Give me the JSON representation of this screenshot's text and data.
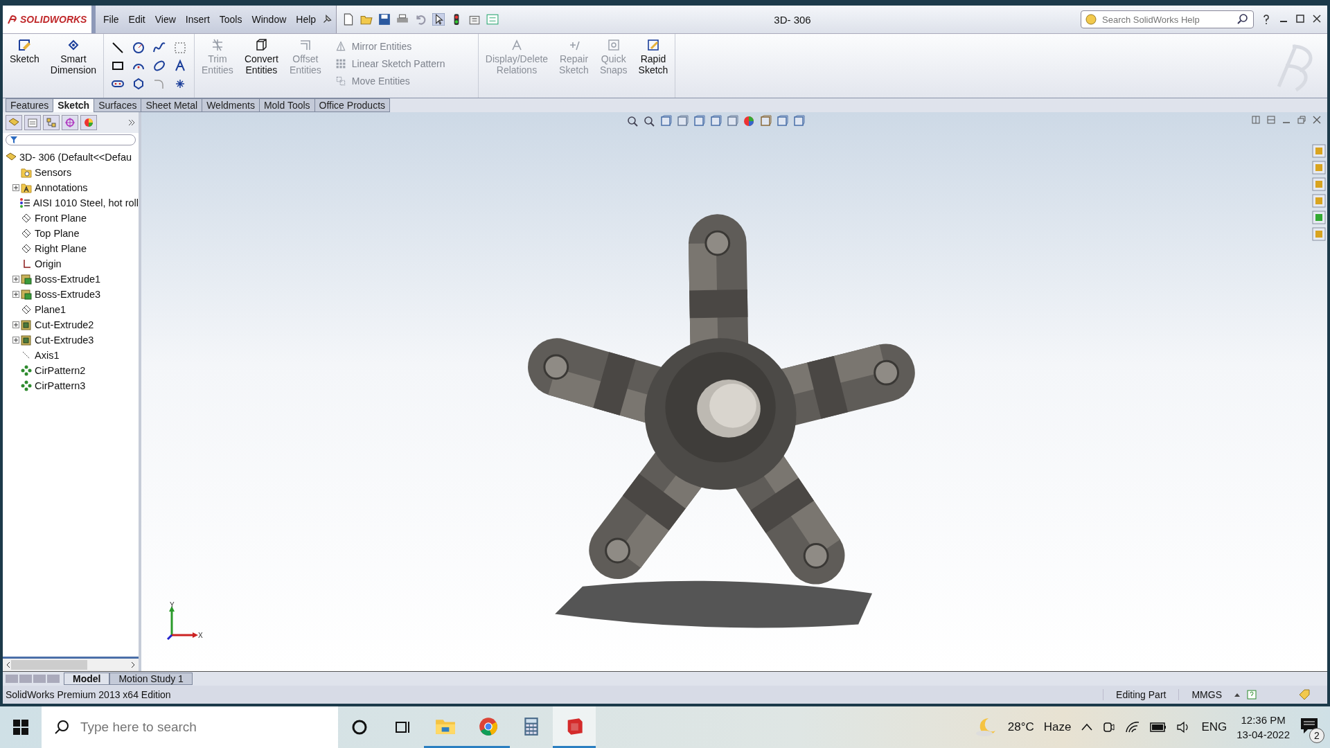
{
  "app": {
    "logo": "SOLIDWORKS",
    "title": "3D- 306"
  },
  "menu": [
    "File",
    "Edit",
    "View",
    "Insert",
    "Tools",
    "Window",
    "Help"
  ],
  "help_search": {
    "placeholder": "Search SolidWorks Help"
  },
  "command_manager": {
    "big_tools": [
      {
        "kind": "sketch",
        "lines": [
          "Sketch"
        ],
        "disabled": false
      },
      {
        "kind": "dimension",
        "lines": [
          "Smart",
          "Dimension"
        ],
        "disabled": false
      }
    ],
    "mid_tools": [
      {
        "kind": "trim",
        "lines": [
          "Trim",
          "Entities"
        ],
        "disabled": true
      },
      {
        "kind": "convert",
        "lines": [
          "Convert",
          "Entities"
        ],
        "disabled": false
      },
      {
        "kind": "offset",
        "lines": [
          "Offset",
          "Entities"
        ],
        "disabled": true
      }
    ],
    "row_tools": [
      {
        "kind": "mirror",
        "label": "Mirror Entities",
        "disabled": true
      },
      {
        "kind": "pattern",
        "label": "Linear Sketch Pattern",
        "disabled": true
      },
      {
        "kind": "move",
        "label": "Move Entities",
        "disabled": true
      }
    ],
    "right_tools": [
      {
        "kind": "relations",
        "lines": [
          "Display/Delete",
          "Relations"
        ],
        "disabled": true
      },
      {
        "kind": "repair",
        "lines": [
          "Repair",
          "Sketch"
        ],
        "disabled": true
      },
      {
        "kind": "snaps",
        "lines": [
          "Quick",
          "Snaps"
        ],
        "disabled": true
      },
      {
        "kind": "rapid",
        "lines": [
          "Rapid",
          "Sketch"
        ],
        "disabled": false
      }
    ]
  },
  "tabs": [
    {
      "label": "Features",
      "selected": false
    },
    {
      "label": "Sketch",
      "selected": true
    },
    {
      "label": "Surfaces",
      "selected": false
    },
    {
      "label": "Sheet Metal",
      "selected": false
    },
    {
      "label": "Weldments",
      "selected": false
    },
    {
      "label": "Mold Tools",
      "selected": false
    },
    {
      "label": "Office Products",
      "selected": false
    }
  ],
  "tree": {
    "root": "3D- 306  (Default<<Defau",
    "children": [
      {
        "kind": "sensor",
        "label": "Sensors",
        "expandable": false
      },
      {
        "kind": "annotation",
        "label": "Annotations",
        "expandable": true
      },
      {
        "kind": "material",
        "label": "AISI 1010 Steel, hot roll",
        "expandable": false
      },
      {
        "kind": "plane",
        "label": "Front Plane",
        "expandable": false
      },
      {
        "kind": "plane",
        "label": "Top Plane",
        "expandable": false
      },
      {
        "kind": "plane",
        "label": "Right Plane",
        "expandable": false
      },
      {
        "kind": "origin",
        "label": "Origin",
        "expandable": false
      },
      {
        "kind": "boss",
        "label": "Boss-Extrude1",
        "expandable": true
      },
      {
        "kind": "boss",
        "label": "Boss-Extrude3",
        "expandable": true
      },
      {
        "kind": "plane",
        "label": "Plane1",
        "expandable": false
      },
      {
        "kind": "cut",
        "label": "Cut-Extrude2",
        "expandable": true
      },
      {
        "kind": "cut",
        "label": "Cut-Extrude3",
        "expandable": true
      },
      {
        "kind": "axis",
        "label": "Axis1",
        "expandable": false
      },
      {
        "kind": "circpattern",
        "label": "CirPattern2",
        "expandable": false
      },
      {
        "kind": "circpattern",
        "label": "CirPattern3",
        "expandable": false
      }
    ]
  },
  "triad": {
    "x": "X",
    "y": "Y"
  },
  "bottom_tabs": [
    {
      "label": "Model",
      "selected": true
    },
    {
      "label": "Motion Study 1",
      "selected": false
    }
  ],
  "status_bar": {
    "edition": "SolidWorks Premium 2013 x64 Edition",
    "mode": "Editing Part",
    "units": "MMGS"
  },
  "taskbar": {
    "search": {
      "placeholder": "Type here to search"
    },
    "apps": [
      {
        "kind": "explorer",
        "open": true,
        "selected": false
      },
      {
        "kind": "chrome",
        "open": true,
        "selected": false
      },
      {
        "kind": "calculator",
        "open": false,
        "selected": false
      },
      {
        "kind": "solidworks",
        "open": true,
        "selected": true
      }
    ],
    "temperature": "28°C",
    "weather": "Haze",
    "language": "ENG",
    "time": "12:36 PM",
    "date": "13-04-2022",
    "notifications": "2"
  }
}
